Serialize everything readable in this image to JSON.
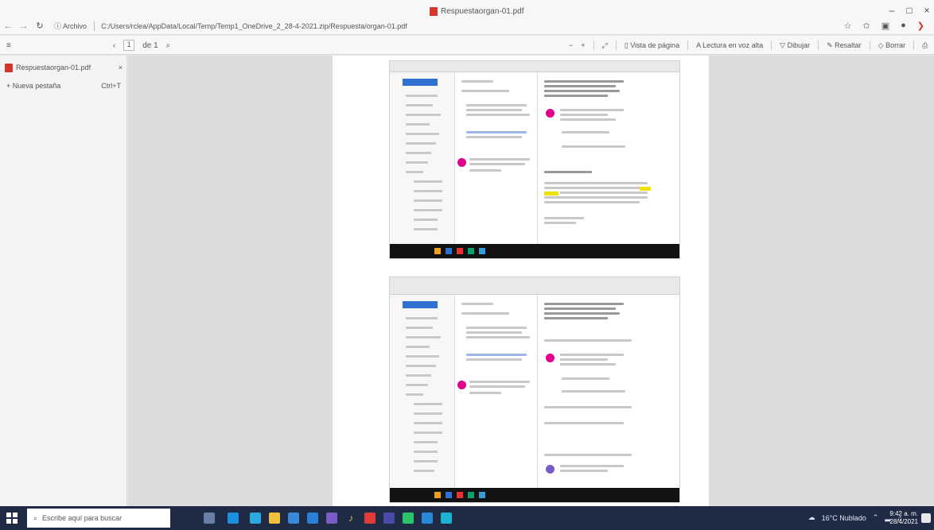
{
  "window": {
    "title": "Respuestaorgan-01.pdf",
    "controls": {
      "minimize": "–",
      "maximize": "□",
      "close": "×"
    }
  },
  "addressbar": {
    "back": "←",
    "forward": "→",
    "refresh": "↻",
    "scheme_label": "Archivo",
    "path": "C:/Users/rclea/AppData/Local/Temp/Temp1_OneDrive_2_28-4-2021.zip/Respuesta/organ-01.pdf",
    "icons": [
      "star-icon",
      "favorites-icon",
      "collections-icon",
      "profile-icon",
      "menu-icon"
    ]
  },
  "pdf_toolbar": {
    "menu_icon": "≡",
    "page_current": "1",
    "page_total": "de 1",
    "search_icon": "⌕",
    "zoom_out": "−",
    "zoom_in": "+",
    "fit_label": "⤢",
    "view_label": "Vista de página",
    "read_aloud_label": "Lectura en voz alta",
    "draw_label": "Dibujar",
    "highlight_label": "Resaltar",
    "erase_label": "Borrar",
    "print_icon": "⎙",
    "save_icon": "⬇"
  },
  "sidebar": {
    "tab_label": "Respuestaorgan-01.pdf",
    "tab_close": "×",
    "item_label": "Nueva pestaña",
    "item_shortcut": "Ctrl+T"
  },
  "taskbar": {
    "search_placeholder": "Escribe aquí para buscar",
    "tray_text": "16°C Nublado",
    "time": "9:42 a. m.",
    "date": "28/4/2021"
  },
  "colors": {
    "accent": "#2f6fd0",
    "pdf_red": "#d4352d",
    "taskbar_bg": "#1f2a44",
    "highlight": "#f0e200",
    "avatar_pink": "#e0008d"
  }
}
